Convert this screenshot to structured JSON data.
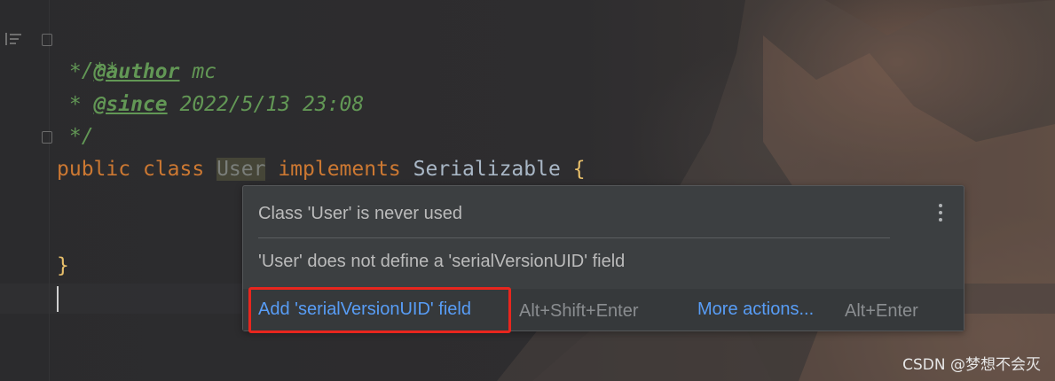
{
  "editor": {
    "lines": {
      "doc_open": "/**",
      "author_prefix": " * ",
      "author_tag": "@author",
      "author_value": " mc",
      "since_prefix": " * ",
      "since_tag": "@since",
      "since_value": " 2022/5/13 23:08",
      "doc_close": " */",
      "kw_public": "public",
      "kw_class": "class",
      "class_name": "User",
      "kw_implements": "implements",
      "interface_name": "Serializable",
      "open_brace": "{",
      "close_brace": "}"
    }
  },
  "popup": {
    "warning_1": "Class 'User' is never used",
    "warning_2": "'User' does not define a 'serialVersionUID' field",
    "primary_action": "Add 'serialVersionUID' field",
    "primary_shortcut": "Alt+Shift+Enter",
    "more_actions": "More actions...",
    "more_shortcut": "Alt+Enter"
  },
  "watermark": "CSDN @梦想不会灭",
  "colors": {
    "comment": "#629755",
    "keyword": "#cc7832",
    "link": "#589df6",
    "highlight": "#e8261e"
  }
}
